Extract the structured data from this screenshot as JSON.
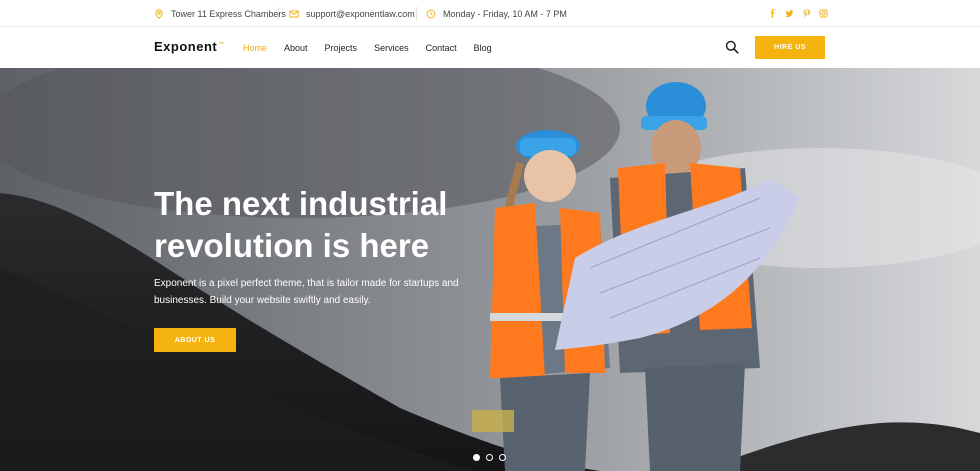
{
  "topbar": {
    "address": "Tower 11 Express Chambers",
    "email": "support@exponentlaw.com",
    "hours": "Monday - Friday, 10 AM - 7 PM",
    "social": [
      "facebook-icon",
      "twitter-icon",
      "pinterest-icon",
      "instagram-icon"
    ]
  },
  "nav": {
    "logo": "Exponent",
    "logo_mark": "™",
    "items": [
      "Home",
      "About",
      "Projects",
      "Services",
      "Contact",
      "Blog"
    ],
    "active": "Home",
    "cta": "HIRE US"
  },
  "hero": {
    "title_line1": "The next industrial",
    "title_line2": "revolution is here",
    "text_line1": "Exponent is a pixel perfect theme, that is tailor made for startups and",
    "text_line2": "businesses. Build your website swiftly and easily.",
    "button": "ABOUT US",
    "slides": 3,
    "active_slide": 1
  },
  "colors": {
    "accent": "#f4b30e",
    "active_link": "#f0a90e"
  }
}
